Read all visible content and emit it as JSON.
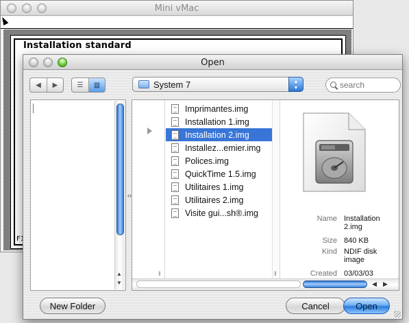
{
  "background_window": {
    "title": "Mini vMac",
    "install_title": "Installation standard",
    "partial_label": "F1"
  },
  "dialog": {
    "title": "Open",
    "path_popup": "System 7",
    "search": {
      "placeholder": "search",
      "value": ""
    },
    "view_mode": "column",
    "files": [
      {
        "name": "Imprimantes.img",
        "selected": false
      },
      {
        "name": "Installation 1.img",
        "selected": false
      },
      {
        "name": "Installation 2.img",
        "selected": true
      },
      {
        "name": "Installez...emier.img",
        "selected": false
      },
      {
        "name": "Polices.img",
        "selected": false
      },
      {
        "name": "QuickTime 1.5.img",
        "selected": false
      },
      {
        "name": "Utilitaires 1.img",
        "selected": false
      },
      {
        "name": "Utilitaires 2.img",
        "selected": false
      },
      {
        "name": "Visite gui...sh®.img",
        "selected": false
      }
    ],
    "preview": {
      "icon": "disk-image-icon",
      "name_label": "Name",
      "name_value": "Installation 2.img",
      "size_label": "Size",
      "size_value": "840 KB",
      "kind_label": "Kind",
      "kind_value": "NDIF disk image",
      "created_label": "Created",
      "created_value": "03/03/03"
    },
    "buttons": {
      "new_folder": "New Folder",
      "cancel": "Cancel",
      "open": "Open"
    }
  },
  "colors": {
    "selection": "#3875d7",
    "aqua_blue": "#2d7ddc",
    "zoom_green": "#6fcf3a"
  }
}
